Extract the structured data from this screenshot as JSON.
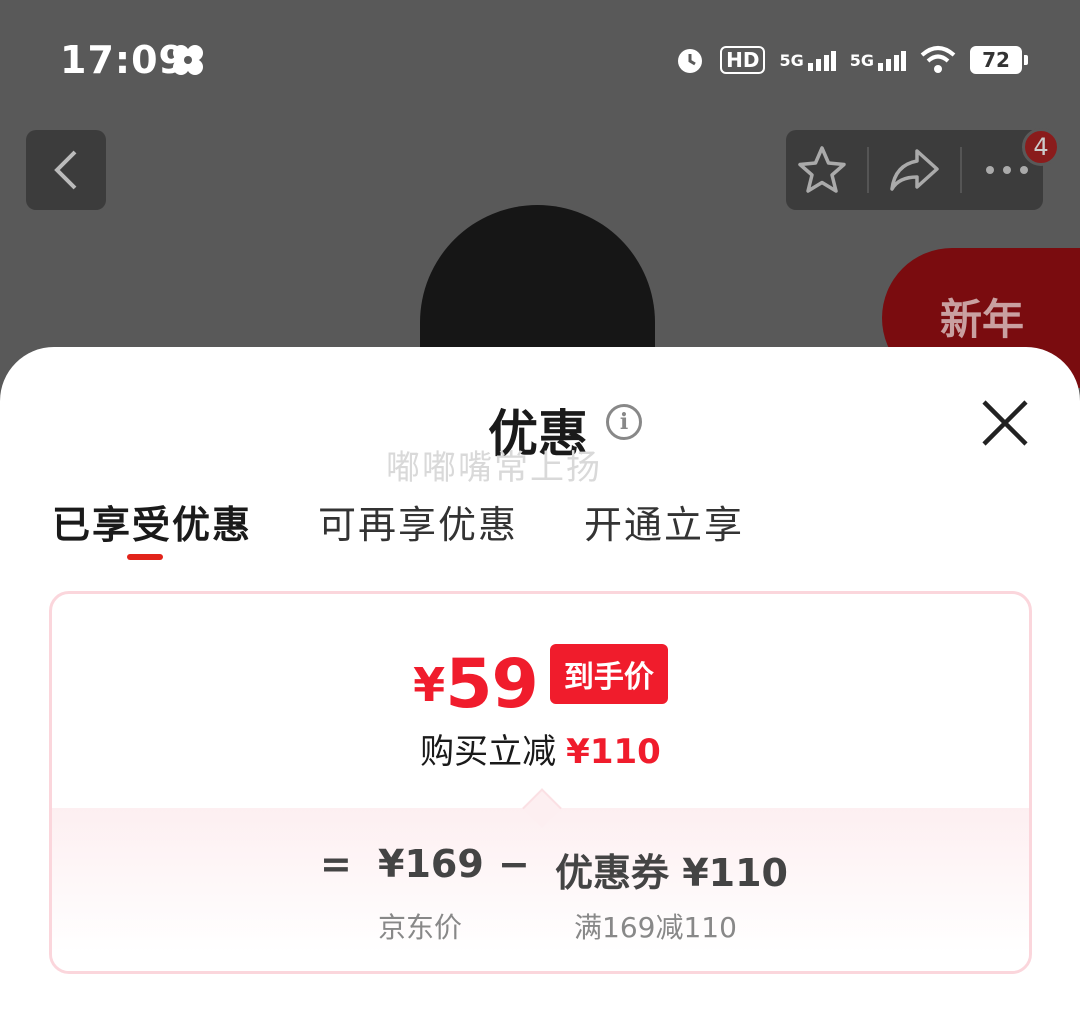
{
  "status_bar": {
    "time": "17:09",
    "network1": "5G",
    "network2": "5G",
    "hd_label": "HD",
    "battery": "72"
  },
  "top_actions": {
    "notification_count": "4"
  },
  "background": {
    "promo_text": "新年"
  },
  "sheet": {
    "title": "优惠",
    "watermark": "嘟嘟嘴常上扬",
    "tabs": [
      {
        "label": "已享受优惠",
        "active": true
      },
      {
        "label": "可再享优惠",
        "active": false
      },
      {
        "label": "开通立享",
        "active": false
      }
    ]
  },
  "card": {
    "currency": "¥",
    "final_price": "59",
    "final_price_tag": "到手价",
    "discount_label": "购买立减",
    "discount_amount": "¥110",
    "equals": "=",
    "jd_price": "¥169",
    "minus": "−",
    "coupon_text": "优惠券 ¥110",
    "jd_price_label": "京东价",
    "coupon_rule": "满169减110"
  },
  "colors": {
    "accent_red": "#f01c2c",
    "tab_underline": "#e2231a",
    "card_border": "#fbd6dc"
  }
}
